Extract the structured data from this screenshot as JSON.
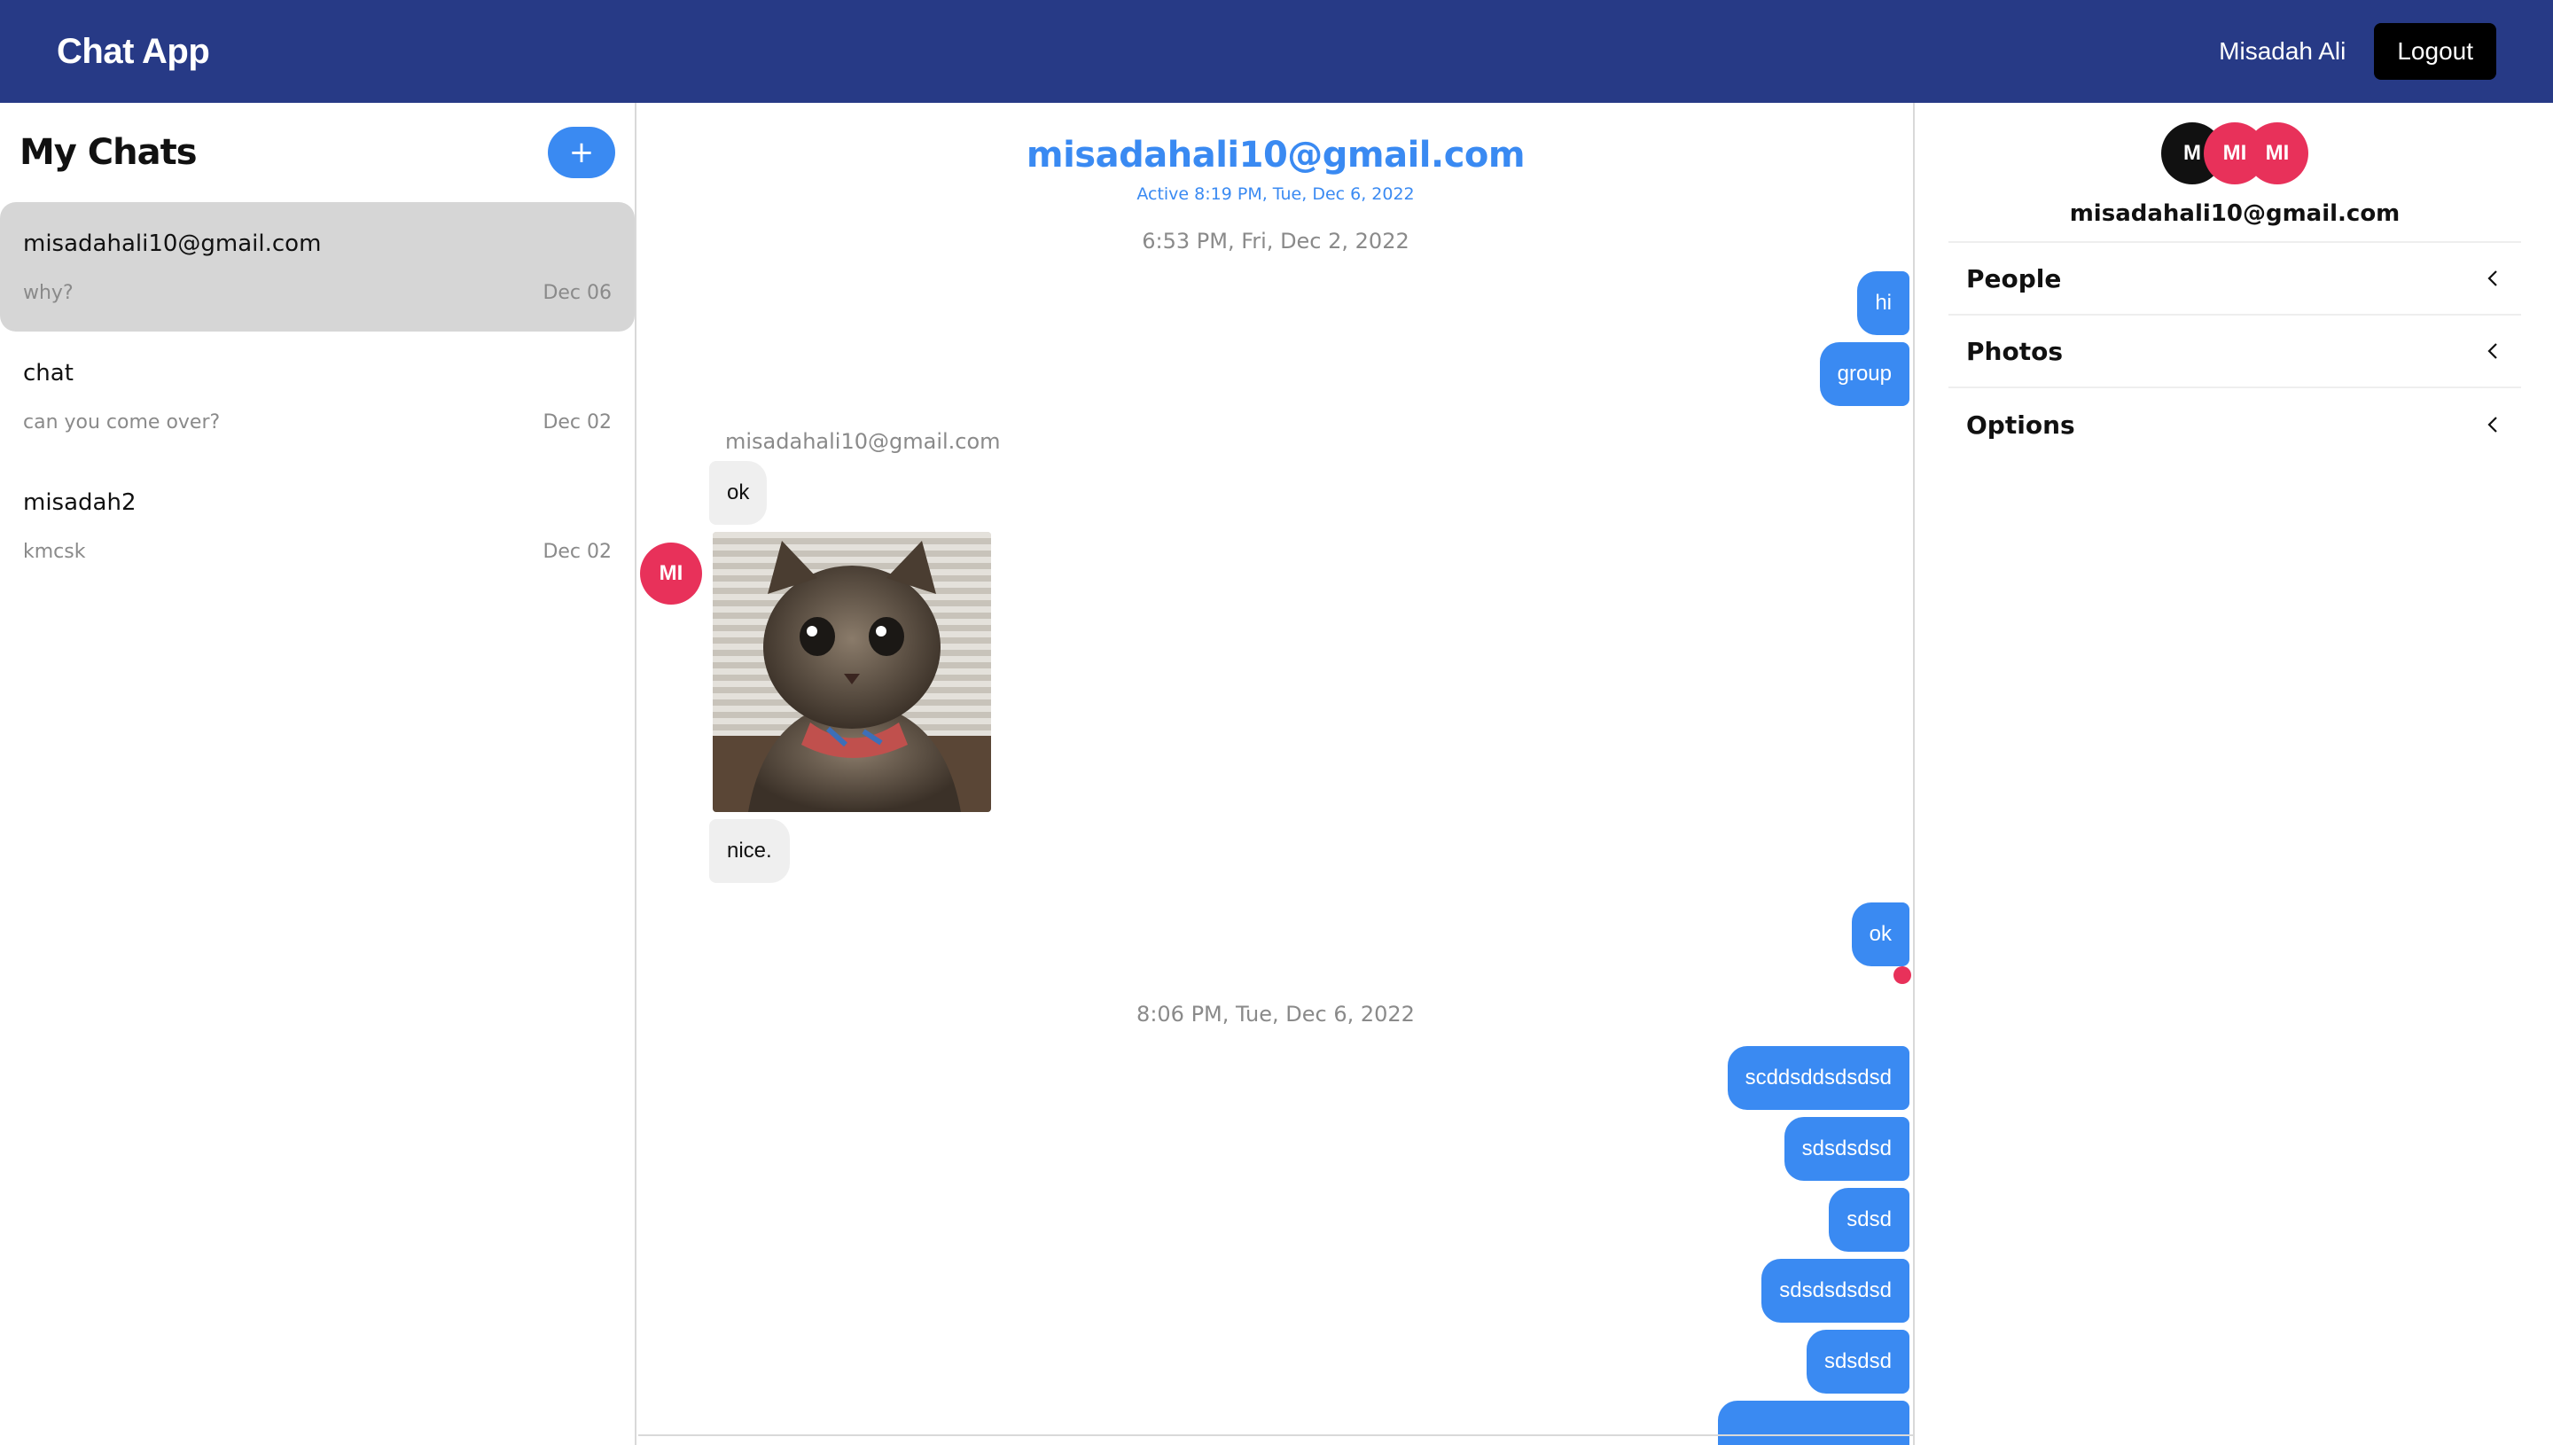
{
  "header": {
    "app_title": "Chat App",
    "user_name": "Misadah Ali",
    "logout_label": "Logout",
    "bg_color": "#273a86"
  },
  "sidebar": {
    "title": "My Chats",
    "new_chat_label": "+",
    "chats": [
      {
        "name": "misadahali10@gmail.com",
        "preview": "why?",
        "date": "Dec 06",
        "active": true
      },
      {
        "name": "chat",
        "preview": "can you come over?",
        "date": "Dec 02",
        "active": false
      },
      {
        "name": "misadah2",
        "preview": "kmcsk",
        "date": "Dec 02",
        "active": false
      }
    ]
  },
  "chat": {
    "title": "misadahali10@gmail.com",
    "subtitle": "Active 8:19 PM, Tue, Dec 6, 2022",
    "accent_color": "#3a8af2",
    "timestamp_1": "6:53 PM, Fri, Dec 2, 2022",
    "timestamp_2": "8:06 PM, Tue, Dec 6, 2022",
    "sender_label": "misadahali10@gmail.com",
    "sender_avatar": "MI",
    "messages_mine_1": [
      "hi",
      "group"
    ],
    "messages_theirs": [
      "ok",
      "nice."
    ],
    "image_description": "cat-photo",
    "message_mine_ok": "ok",
    "messages_mine_2": [
      "scddsddsdsdsd",
      "sdsdsdsd",
      "sdsd",
      "sdsdsdsdsd",
      "sdsdsd"
    ]
  },
  "details": {
    "avatars": [
      "M",
      "MI",
      "MI"
    ],
    "email": "misadahali10@gmail.com",
    "sections": [
      {
        "label": "People",
        "icon": "chevron-left-icon"
      },
      {
        "label": "Photos",
        "icon": "chevron-left-icon"
      },
      {
        "label": "Options",
        "icon": "chevron-left-icon"
      }
    ]
  }
}
